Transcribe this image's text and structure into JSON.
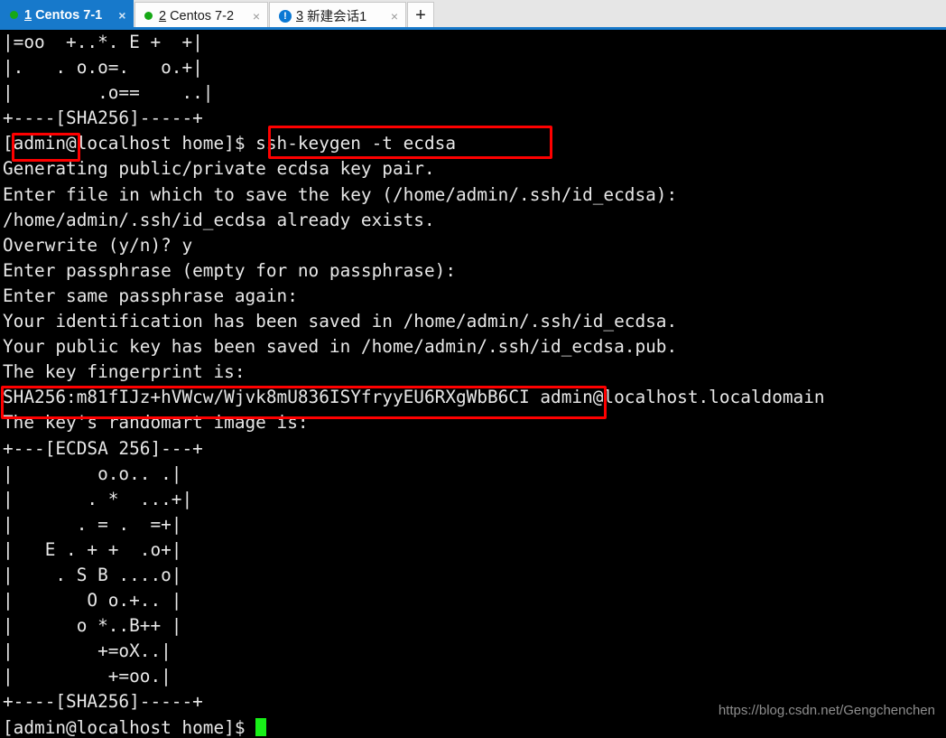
{
  "window": {
    "title": "Centos 7-1",
    "accent_color": "#1779cb",
    "terminal_bg": "#000000",
    "terminal_fg": "#e8e8e8",
    "cursor_color": "#18f018",
    "annotation_color": "#fe0000"
  },
  "tabbar": {
    "tabs": [
      {
        "index": "1",
        "label": "Centos 7-1",
        "status_icon": "green-dot-icon",
        "active": true,
        "close_label": "×"
      },
      {
        "index": "2",
        "label": "Centos 7-2",
        "status_icon": "green-dot-icon",
        "active": false,
        "close_label": "×"
      },
      {
        "index": "3",
        "label": "新建会话1",
        "status_icon": "info-alert-icon",
        "alert_glyph": "!",
        "active": false,
        "close_label": "×"
      }
    ],
    "new_tab_label": "+"
  },
  "terminal": {
    "lines": [
      "|=oo  +..*. E +  +|",
      "|.   . o.o=.   o.+|",
      "|        .o==    ..|",
      "+----[SHA256]-----+",
      "[admin@localhost home]$ ssh-keygen -t ecdsa",
      "Generating public/private ecdsa key pair.",
      "Enter file in which to save the key (/home/admin/.ssh/id_ecdsa):",
      "/home/admin/.ssh/id_ecdsa already exists.",
      "Overwrite (y/n)? y",
      "Enter passphrase (empty for no passphrase):",
      "Enter same passphrase again:",
      "Your identification has been saved in /home/admin/.ssh/id_ecdsa.",
      "Your public key has been saved in /home/admin/.ssh/id_ecdsa.pub.",
      "The key fingerprint is:",
      "SHA256:m81fIJz+hVWcw/Wjvk8mU836ISYfryyEU6RXgWbB6CI admin@localhost.localdomain",
      "The key's randomart image is:",
      "+---[ECDSA 256]---+",
      "|        o.o.. .|",
      "|       . *  ...+|",
      "|      . = .  =+|",
      "|   E . + +  .o+|",
      "|    . S B ....o|",
      "|       O o.+.. |",
      "|      o *..B++ |",
      "|        +=oX..|",
      "|         +=oo.|",
      "+----[SHA256]-----+",
      "[admin@localhost home]$ "
    ],
    "command": "ssh-keygen -t ecdsa",
    "prompt": "[admin@localhost home]$",
    "highlighted_user": "admin",
    "fingerprint": "SHA256:m81fIJz+hVWcw/Wjvk8mU836ISYfryyEU6RXgWbB6CI",
    "fingerprint_owner": "admin@localhost.localdomain"
  },
  "watermark": {
    "text": "https://blog.csdn.net/Gengchenchen"
  }
}
